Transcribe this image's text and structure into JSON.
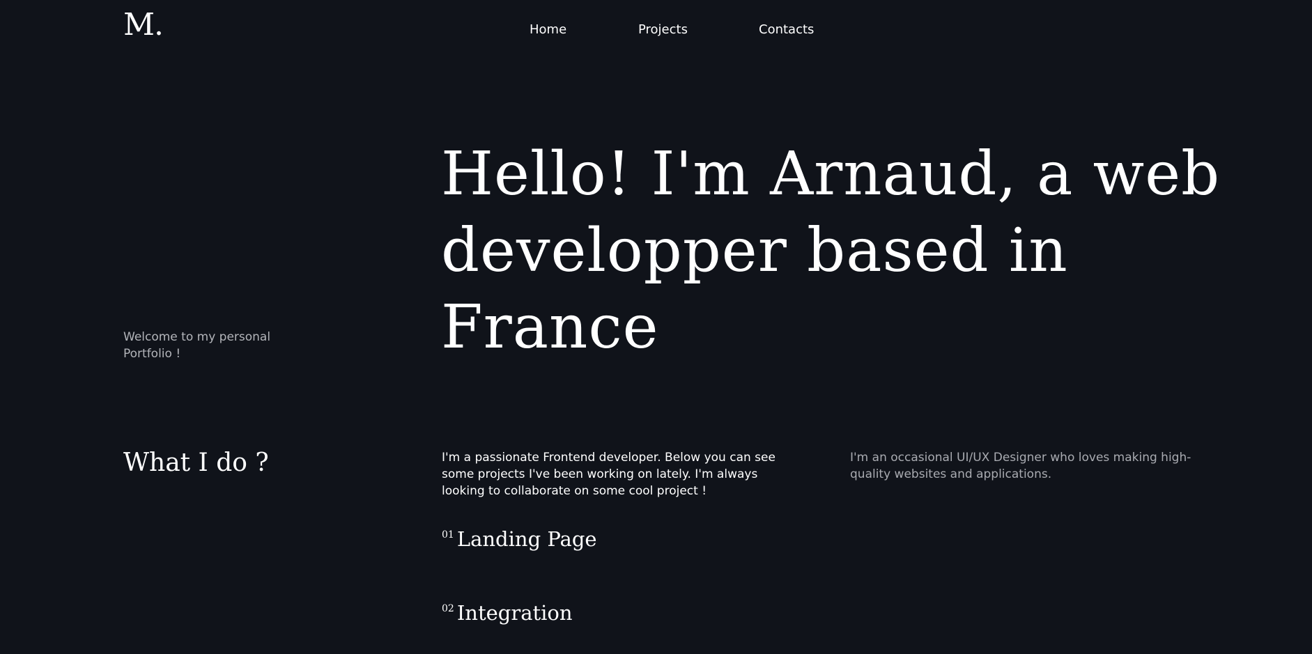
{
  "header": {
    "logo": "M.",
    "nav": {
      "home": "Home",
      "projects": "Projects",
      "contacts": "Contacts"
    }
  },
  "hero": {
    "welcome": "Welcome to my personal Portfolio !",
    "headline": "Hello! I'm Arnaud, a web developper based in France"
  },
  "services": {
    "title": "What I do ?",
    "intro": "I'm a passionate Frontend developer. Below you can see some projects I've been working on lately. I'm always looking to collaborate on some cool project !",
    "designer": "I'm an occasional UI/UX Designer who loves making high-quality websites and applications.",
    "items": [
      {
        "number": "01",
        "label": "Landing Page"
      },
      {
        "number": "02",
        "label": "Integration"
      }
    ]
  },
  "colors": {
    "background": "#10131a",
    "text": "#ffffff",
    "muted": "#a9abb1"
  }
}
